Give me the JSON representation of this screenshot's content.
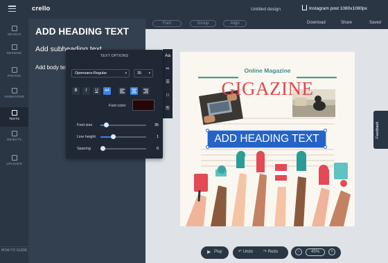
{
  "app": {
    "logo": "crello",
    "document_title": "Untitled design",
    "format": "Instagram post 1080x1080px"
  },
  "toolbar": {
    "undo_pill": "Font",
    "redo_pill": "Group",
    "align_pill": "Align",
    "download": "Download",
    "share": "Share",
    "saved": "Saved"
  },
  "sidebar": {
    "items": [
      {
        "label": "SEARCH",
        "icon": "search-icon"
      },
      {
        "label": "DESIGNS",
        "icon": "designs-icon"
      },
      {
        "label": "PHOTOS",
        "icon": "photos-icon"
      },
      {
        "label": "ANIMATIONS",
        "icon": "animations-icon"
      },
      {
        "label": "TEXTS",
        "icon": "texts-icon"
      },
      {
        "label": "OBJECTS",
        "icon": "objects-icon"
      },
      {
        "label": "UPLOADS",
        "icon": "uploads-icon"
      }
    ],
    "active": "TEXTS",
    "howto": "HOW-TO GUIDE"
  },
  "text_panel": {
    "heading": "ADD HEADING TEXT",
    "subheading": "Add subheading text",
    "body": "Add body text"
  },
  "text_options": {
    "title": "TEXT OPTIONS",
    "font_family": "Opensans-Regular",
    "font_size": "35",
    "format_buttons": [
      "B",
      "I",
      "U",
      "AA"
    ],
    "font_color_label": "Font color",
    "font_color": "#2a0505",
    "sliders": [
      {
        "label": "Font size",
        "value": "35",
        "fraction": 0.12
      },
      {
        "label": "Line height",
        "value": "1",
        "fraction": 0.28
      },
      {
        "label": "Spacing",
        "value": "0",
        "fraction": 0.05
      }
    ]
  },
  "vertical_tools": [
    "Aa",
    "✂",
    "☰",
    "□",
    "⎘"
  ],
  "design": {
    "magazine": "Online Magazine",
    "title": "GIGAZINE",
    "heading": "ADD HEADING TEXT"
  },
  "feedback": "Feedback",
  "bottom": {
    "play": "Play",
    "undo": "Undo",
    "redo": "Redo",
    "zoom": "45%"
  }
}
